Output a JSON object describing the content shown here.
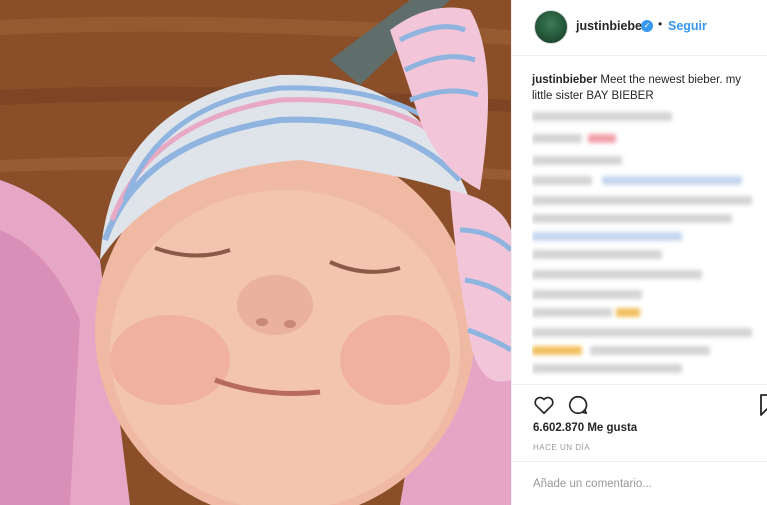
{
  "photo": {
    "alt_icon": "newborn-baby-photo"
  },
  "header": {
    "username": "justinbieber",
    "verified_icon": "verified-badge-icon",
    "dot": "•",
    "follow_label": "Seguir"
  },
  "caption": {
    "username": "justinbieber",
    "text": "Meet the newest bieber. my little sister BAY BIEBER"
  },
  "actions": {
    "like_icon": "heart-icon",
    "comment_icon": "comment-icon",
    "save_icon": "bookmark-icon",
    "likes_text": "6.602.870 Me gusta",
    "time_text": "HACE UN DÍA"
  },
  "add_comment": {
    "placeholder": "Añade un comentario..."
  },
  "colors": {
    "link": "#3897f0",
    "text": "#262626",
    "muted": "#999999"
  }
}
